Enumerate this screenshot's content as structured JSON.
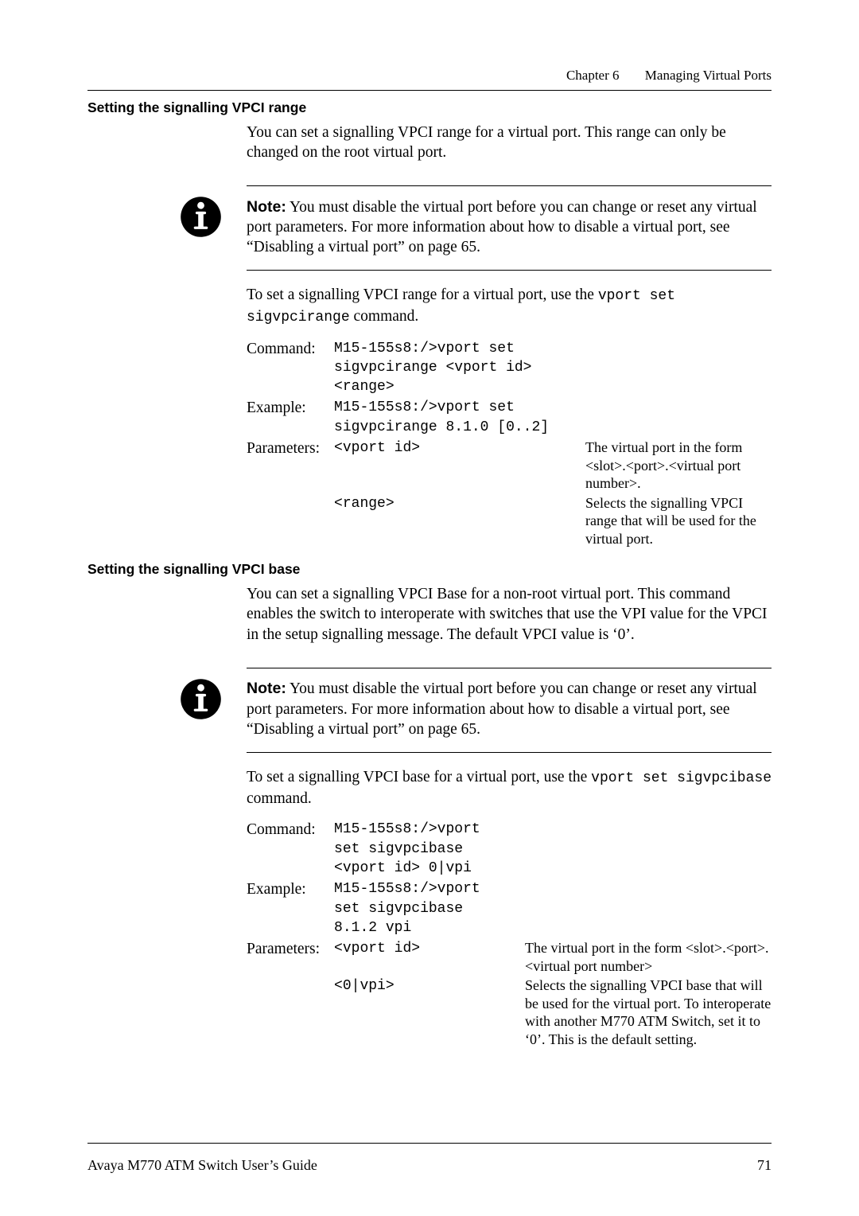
{
  "header": {
    "chapter": "Chapter 6",
    "title": "Managing Virtual Ports"
  },
  "sectionA": {
    "title": "Setting the signalling VPCI range",
    "intro": "You can set a signalling VPCI range for a virtual port. This range can only be changed on the root virtual port.",
    "note_label": "Note:",
    "note_body": "  You must disable the virtual port before you can change or reset any virtual port parameters. For more information about how to disable a virtual port, see “Disabling a virtual port” on page 65.",
    "after_note_1": "To set a signalling VPCI range for a virtual port, use the ",
    "after_note_cmd": "vport set sigvpcirange",
    "after_note_2": " command.",
    "labels": {
      "command": "Command:",
      "example": "Example:",
      "params": "Parameters:"
    },
    "command": "M15-155s8:/>vport set sigvpcirange <vport id> <range>",
    "example": "M15-155s8:/>vport set sigvpcirange 8.1.0 [0..2]",
    "p1_arg": "<vport id>",
    "p1_desc": "The virtual port in the form <slot>.<port>.<virtual port number>.",
    "p2_arg": "<range>",
    "p2_desc": "Selects the signalling VPCI range that will be used for the virtual port."
  },
  "sectionB": {
    "title": "Setting the signalling VPCI base",
    "intro": "You can set a signalling VPCI Base for a non-root virtual port. This command enables the switch to interoperate with switches that use the VPI value for the VPCI in the setup signalling message. The default VPCI value is ‘0’.",
    "note_label": "Note:",
    "note_body": "  You must disable the virtual port before you can change or reset any virtual port parameters. For more information about how to disable a virtual port, see “Disabling a virtual port” on page 65.",
    "after_note_1": "To set a signalling VPCI base for a virtual port, use the ",
    "after_note_cmd": "vport set sigvpcibase",
    "after_note_2": " command.",
    "labels": {
      "command": "Command:",
      "example": "Example:",
      "params": "Parameters:"
    },
    "command": "M15-155s8:/>vport set sigvpcibase <vport id> 0|vpi",
    "example": "M15-155s8:/>vport set sigvpcibase 8.1.2 vpi",
    "p1_arg": "<vport id>",
    "p1_desc": "The virtual port in the form <slot>.<port>.<virtual port number>",
    "p2_arg": "<0|vpi>",
    "p2_desc": "Selects the signalling VPCI base that will be used for the virtual port. To interoperate with another M770 ATM Switch, set it to ‘0’. This is the default setting."
  },
  "footer": {
    "left": "Avaya M770 ATM Switch User’s Guide",
    "right": "71"
  }
}
